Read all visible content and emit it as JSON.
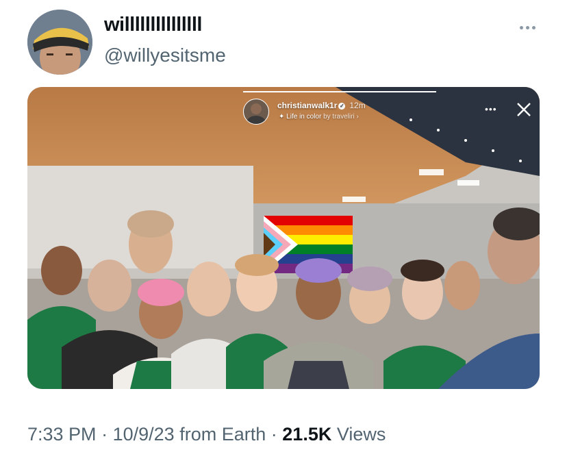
{
  "author": {
    "display_name": "willlllllllllllll",
    "handle": "@willyesitsme",
    "avatar_icon": "profile-avatar"
  },
  "more_icon": "more-horizontal-icon",
  "media": {
    "story": {
      "username": "christianwalk1r",
      "time": "12m",
      "music_prefix": "Life in color",
      "music_by": "by traveliri",
      "music_icon": "sparkle-music-icon"
    }
  },
  "meta": {
    "time": "7:33 PM",
    "separator": "·",
    "date": "10/9/23",
    "source": "from Earth",
    "views_count": "21.5K",
    "views_label": "Views"
  },
  "colors": {
    "apron_green": "#1e7a44",
    "pride_flag": [
      "#e40303",
      "#ff8c00",
      "#ffed00",
      "#008026",
      "#24408e",
      "#732982"
    ],
    "muted_text": "#536471"
  }
}
